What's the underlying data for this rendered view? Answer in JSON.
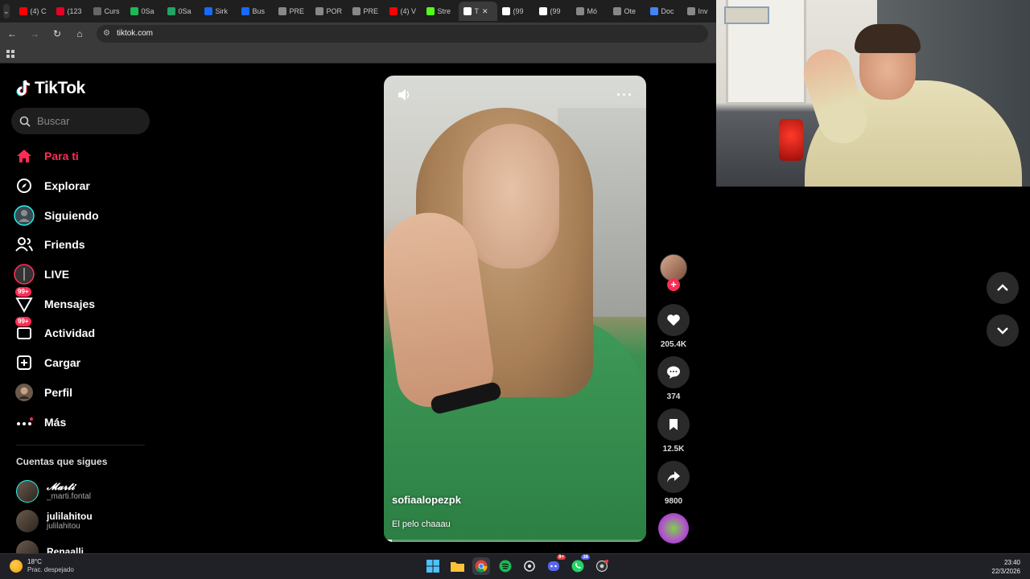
{
  "browser": {
    "tabs": [
      {
        "label": "(4) C",
        "color": "#ff0000"
      },
      {
        "label": "(123",
        "color": "#e60023"
      },
      {
        "label": "Curs",
        "color": "#666666"
      },
      {
        "label": "0Sa",
        "color": "#1db954"
      },
      {
        "label": "0Sa",
        "color": "#1fa463"
      },
      {
        "label": "Sirk",
        "color": "#1769ff"
      },
      {
        "label": "Bus",
        "color": "#1769ff"
      },
      {
        "label": "PRE",
        "color": "#888888"
      },
      {
        "label": "POR",
        "color": "#888888"
      },
      {
        "label": "PRE",
        "color": "#888888"
      },
      {
        "label": "(4) V",
        "color": "#ff0000"
      },
      {
        "label": "Stre",
        "color": "#53fc18"
      },
      {
        "label": "T",
        "color": "#ffffff",
        "active": true
      },
      {
        "label": "(99",
        "color": "#ffffff"
      },
      {
        "label": "(99",
        "color": "#ffffff"
      },
      {
        "label": "Mó",
        "color": "#888888"
      },
      {
        "label": "Ote",
        "color": "#888888"
      },
      {
        "label": "Doc",
        "color": "#4285f4"
      },
      {
        "label": "Inv",
        "color": "#888888"
      }
    ],
    "url": "tiktok.com"
  },
  "sidebar": {
    "brand": "TikTok",
    "search_placeholder": "Buscar",
    "nav": [
      {
        "label": "Para ti",
        "icon": "home-icon",
        "active": true
      },
      {
        "label": "Explorar",
        "icon": "compass-icon"
      },
      {
        "label": "Siguiendo",
        "icon": "following-avatar-icon"
      },
      {
        "label": "Friends",
        "icon": "friends-icon"
      },
      {
        "label": "LIVE",
        "icon": "live-icon"
      },
      {
        "label": "Mensajes",
        "icon": "messages-icon",
        "badge": "99+"
      },
      {
        "label": "Actividad",
        "icon": "activity-icon",
        "badge": "99+"
      },
      {
        "label": "Cargar",
        "icon": "upload-icon"
      },
      {
        "label": "Perfil",
        "icon": "profile-avatar-icon"
      },
      {
        "label": "Más",
        "icon": "more-icon"
      }
    ],
    "following_title": "Cuentas que sigues",
    "following": [
      {
        "name": "𝓜𝓪𝓻𝓽𝓲",
        "handle": "_marti.fontal"
      },
      {
        "name": "julilahitou",
        "handle": "julilahitou"
      },
      {
        "name": "Renaalli",
        "handle": ""
      }
    ]
  },
  "video": {
    "username": "sofiaalopezpk",
    "caption": "El pelo chaaau",
    "progress": 0.03
  },
  "actions": {
    "likes": "205.4K",
    "comments": "374",
    "saves": "12.5K",
    "shares": "9800"
  },
  "taskbar": {
    "temp": "18°C",
    "weather": "Prac. despejado",
    "time": "23:40",
    "date": "22/3/2026",
    "discord_badge": "9+",
    "whatsapp_badge": "38"
  },
  "colors": {
    "accent": "#fe2c55",
    "background": "#000000"
  }
}
